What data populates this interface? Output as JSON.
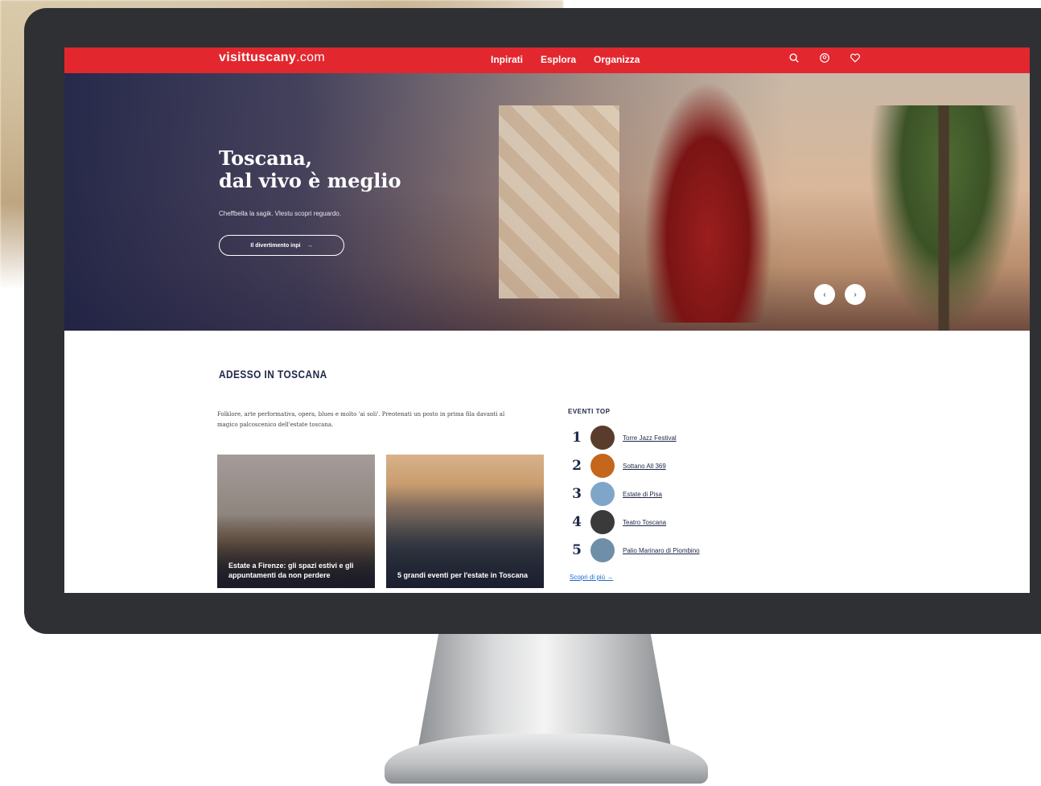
{
  "site": {
    "logo": "visittuscany",
    "logo_domain": ".com",
    "brand_color": "#e2272f"
  },
  "nav": {
    "items": [
      "Inpirati",
      "Esplora",
      "Organizza"
    ],
    "icons": [
      "search-icon",
      "user-icon",
      "heart-icon"
    ]
  },
  "hero": {
    "title_line1": "Toscana,",
    "title_line2": "dal vivo è meglio",
    "subtitle": "Cheffbella la sagik. Vlestu scopri reguardo.",
    "cta_label": "Il divertimento inpi",
    "slider_prev": "‹",
    "slider_next": "›"
  },
  "section": {
    "title": "ADESSO IN TOSCANA",
    "intro": "Folklore, arte performativa, opera, blues e molto 'ai soli'. Preotenati un posto in prima fila davanti al magico palcoscenico dell'estate toscana.",
    "cards": [
      {
        "caption": "Estate a Firenze: gli spazi estivi e gli appuntamenti da non perdere"
      },
      {
        "caption": "5 grandi eventi per l'estate in Toscana"
      }
    ]
  },
  "events": {
    "heading": "EVENTI TOP",
    "items": [
      {
        "rank": "1",
        "label": "Torre Jazz Festival",
        "thumb_color": "#5a3c2c"
      },
      {
        "rank": "2",
        "label": "Sottano All 369",
        "thumb_color": "#c4671c"
      },
      {
        "rank": "3",
        "label": "Estate di Pisa",
        "thumb_color": "#7fa6c9"
      },
      {
        "rank": "4",
        "label": "Teatro Toscana",
        "thumb_color": "#3a3a3a"
      },
      {
        "rank": "5",
        "label": "Palio Marinaro di Piombino",
        "thumb_color": "#6f8fa8"
      }
    ],
    "see_all": "Scopri di più →"
  }
}
